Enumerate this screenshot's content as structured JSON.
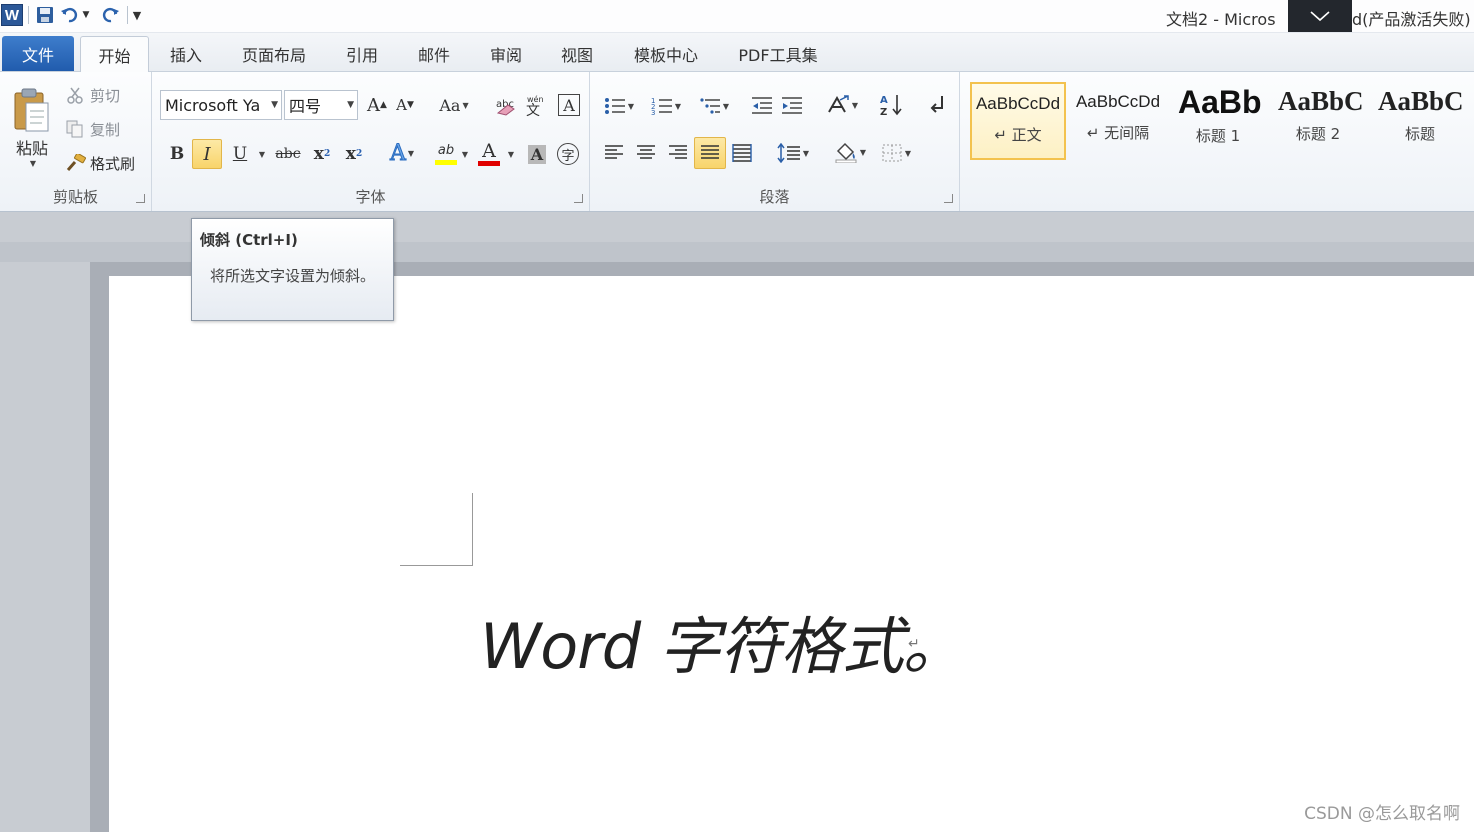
{
  "window": {
    "title_left": "文档2 - Micros",
    "title_right": "d(产品激活失败)"
  },
  "qat": {
    "icons": [
      "word-app-icon",
      "save-icon",
      "undo-icon",
      "redo-icon",
      "customize-dropdown-icon"
    ]
  },
  "tabs": {
    "file": "文件",
    "home": "开始",
    "insert": "插入",
    "page_layout": "页面布局",
    "references": "引用",
    "mailings": "邮件",
    "review": "审阅",
    "view": "视图",
    "templates": "模板中心",
    "pdf_tools": "PDF工具集"
  },
  "clipboard": {
    "paste": "粘贴",
    "cut": "剪切",
    "copy": "复制",
    "format_painter": "格式刷",
    "group_label": "剪贴板"
  },
  "font": {
    "font_name": "Microsoft Ya",
    "font_size": "四号",
    "grow_font": "A",
    "shrink_font": "A",
    "change_case": "Aa",
    "clear_format_glyph": "A",
    "bold": "B",
    "italic": "I",
    "underline": "U",
    "strikethrough": "abc",
    "subscript": "x",
    "superscript": "x",
    "text_effects": "A",
    "highlight": "ab",
    "font_color": "A",
    "char_shading": "A",
    "enclose_char": "字",
    "group_label": "字体"
  },
  "paragraph": {
    "group_label": "段落"
  },
  "styles": {
    "items": [
      {
        "sample": "AaBbCcDd",
        "name": "↵ 正文"
      },
      {
        "sample": "AaBbCcDd",
        "name": "↵ 无间隔"
      },
      {
        "sample": "AaBb",
        "name": "标题 1"
      },
      {
        "sample": "AaBbC",
        "name": "标题 2"
      },
      {
        "sample": "AaBbC",
        "name": "标题"
      }
    ]
  },
  "tooltip": {
    "title": "倾斜 (Ctrl+I)",
    "body": "将所选文字设置为倾斜。"
  },
  "document": {
    "text": "Word 字符格式。",
    "para_mark": "↵"
  },
  "watermark": "CSDN @怎么取名啊",
  "colors": {
    "file_tab": "#2b63b5",
    "highlight_button": "#f8d46b",
    "font_color_bar": "#e00000",
    "highlight_bar": "#ffff00"
  }
}
